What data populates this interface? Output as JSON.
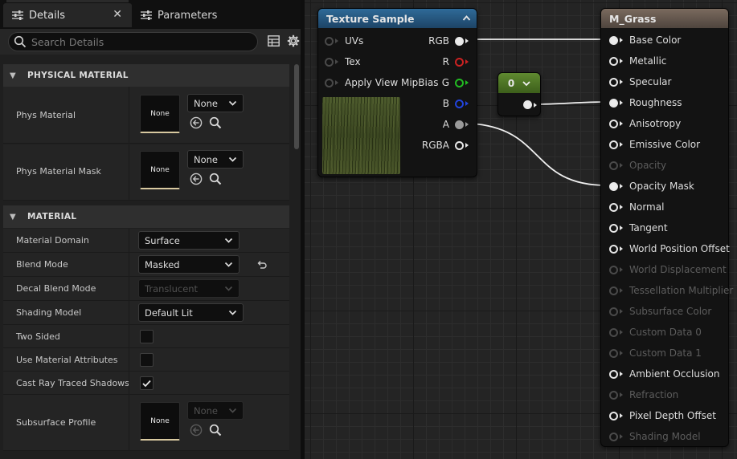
{
  "tabs": {
    "details_label": "Details",
    "close_glyph": "✕",
    "parameters_label": "Parameters"
  },
  "search": {
    "placeholder": "Search Details"
  },
  "icons": {
    "details_tab": "sliders-icon",
    "parameters_tab": "sliders-icon",
    "search": "search-icon",
    "table_view": "table-icon",
    "settings": "gear-icon",
    "reset": "reset-arrow-icon",
    "browse": "arrow-left-circle-icon",
    "find": "magnifier-icon",
    "dropdown": "chevron-down-icon",
    "check": "checkmark-icon",
    "collapse": "chevron-up-icon"
  },
  "colors": {
    "texture_header": "#1f4a6b",
    "material_header": "#5e524a",
    "constant_header": "#4d7222",
    "thumb_accent": "#d8c9a0",
    "pin_red": "#cc2222",
    "pin_green": "#22bb22",
    "pin_blue": "#2244dd"
  },
  "physical_material": {
    "title": "PHYSICAL MATERIAL",
    "rows": [
      {
        "label": "Phys Material",
        "thumb": "None",
        "combo": "None"
      },
      {
        "label": "Phys Material Mask",
        "thumb": "None",
        "combo": "None"
      }
    ]
  },
  "material": {
    "title": "MATERIAL",
    "material_domain": {
      "label": "Material Domain",
      "value": "Surface"
    },
    "blend_mode": {
      "label": "Blend Mode",
      "value": "Masked"
    },
    "decal_blend_mode": {
      "label": "Decal Blend Mode",
      "value": "Translucent"
    },
    "shading_model": {
      "label": "Shading Model",
      "value": "Default Lit"
    },
    "two_sided": {
      "label": "Two Sided",
      "checked": false
    },
    "use_material_attributes": {
      "label": "Use Material Attributes",
      "checked": false
    },
    "cast_ray_traced_shadows": {
      "label": "Cast Ray Traced Shadows",
      "checked": true
    },
    "subsurface_profile": {
      "label": "Subsurface Profile",
      "thumb": "None",
      "combo": "None"
    }
  },
  "texture_sample": {
    "title": "Texture Sample",
    "inputs": [
      "UVs",
      "Tex",
      "Apply View MipBias"
    ],
    "outputs": [
      "RGB",
      "R",
      "G",
      "B",
      "A",
      "RGBA"
    ]
  },
  "constant_node": {
    "value": "0"
  },
  "material_node": {
    "title": "M_Grass",
    "pins": [
      {
        "label": "Base Color",
        "enabled": true,
        "connected": true
      },
      {
        "label": "Metallic",
        "enabled": true,
        "connected": false
      },
      {
        "label": "Specular",
        "enabled": true,
        "connected": false
      },
      {
        "label": "Roughness",
        "enabled": true,
        "connected": true
      },
      {
        "label": "Anisotropy",
        "enabled": true,
        "connected": false
      },
      {
        "label": "Emissive Color",
        "enabled": true,
        "connected": false
      },
      {
        "label": "Opacity",
        "enabled": false,
        "connected": false
      },
      {
        "label": "Opacity Mask",
        "enabled": true,
        "connected": true
      },
      {
        "label": "Normal",
        "enabled": true,
        "connected": false
      },
      {
        "label": "Tangent",
        "enabled": true,
        "connected": false
      },
      {
        "label": "World Position Offset",
        "enabled": true,
        "connected": false
      },
      {
        "label": "World Displacement",
        "enabled": false,
        "connected": false
      },
      {
        "label": "Tessellation Multiplier",
        "enabled": false,
        "connected": false
      },
      {
        "label": "Subsurface Color",
        "enabled": false,
        "connected": false
      },
      {
        "label": "Custom Data 0",
        "enabled": false,
        "connected": false
      },
      {
        "label": "Custom Data 1",
        "enabled": false,
        "connected": false
      },
      {
        "label": "Ambient Occlusion",
        "enabled": true,
        "connected": false
      },
      {
        "label": "Refraction",
        "enabled": false,
        "connected": false
      },
      {
        "label": "Pixel Depth Offset",
        "enabled": true,
        "connected": false
      },
      {
        "label": "Shading Model",
        "enabled": false,
        "connected": false
      }
    ]
  }
}
